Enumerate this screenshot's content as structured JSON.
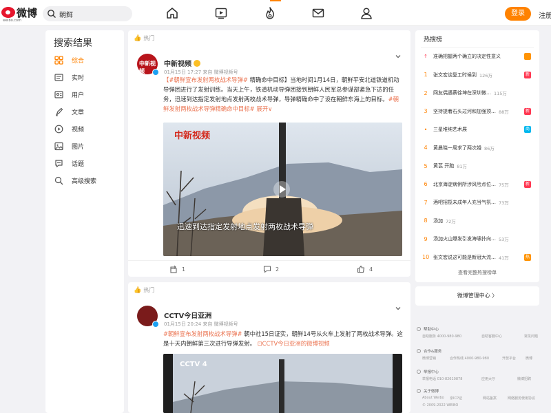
{
  "header": {
    "logo_text": "微博",
    "logo_sub": "weibo.com",
    "search_value": "朝鲜",
    "login_label": "登录",
    "register_label": "注册",
    "nav_icons": [
      "home-icon",
      "video-icon",
      "hot-fire-icon",
      "message-icon",
      "profile-icon"
    ]
  },
  "sidebar": {
    "title": "搜索结果",
    "items": [
      {
        "label": "综合",
        "icon": "grid-icon"
      },
      {
        "label": "实时",
        "icon": "realtime-icon"
      },
      {
        "label": "用户",
        "icon": "user-icon"
      },
      {
        "label": "文章",
        "icon": "article-icon"
      },
      {
        "label": "视频",
        "icon": "video-play-icon"
      },
      {
        "label": "图片",
        "icon": "image-icon"
      },
      {
        "label": "话题",
        "icon": "topic-icon"
      },
      {
        "label": "高级搜索",
        "icon": "advanced-search-icon"
      }
    ]
  },
  "posts": [
    {
      "tag": "热门",
      "author": "中新视频",
      "meta": "01月15日 17:27  来自 微博视频号",
      "text_hashtag": "【#朝鲜宣布发射两枚战术导弹#",
      "text_body": " 精确命中目标】当地时间1月14日，朝鲜平安北道铁道机动导弹团进行了发射训练。当天上午，铁道机动导弹团接到朝鲜人民军总参谋部紧急下达的任务，迅速到达指定发射地点发射两枚战术导弹，导弹精确命中了设在朝鲜东海上的目标。",
      "text_hashtag2": "#朝鲜发射两枚战术导弹精确命中目标#",
      "expand": " 展开∨",
      "media_watermark": "中新视频",
      "media_caption": "迅速到达指定发射地点发射两枚战术导弹",
      "repost": "",
      "comments": "2",
      "likes": "4",
      "repost_count": "1"
    },
    {
      "tag": "热门",
      "author": "CCTV今日亚洲",
      "meta": "01月15日 20:24  来自 微博视频号",
      "text_hashtag": "#朝鲜宣布发射两枚战术导弹#",
      "text_body": " 朝中社15日证实，朝鲜14号从火车上发射了两枚战术导弹。这是十天内朝鲜第三次进行导弹发射。",
      "text_link": " ⊡CCTV今日亚洲的微博视频",
      "media_watermark": "CCTV 4"
    }
  ],
  "hot_search": {
    "title": "热搜榜",
    "items": [
      {
        "rank": "↑",
        "word": "准确把握两个确立的决定性意义",
        "num": "",
        "badge": "",
        "badge_color": "#ff9406"
      },
      {
        "rank": "1",
        "word": "张文宏谈复工时候到",
        "num": "126万",
        "badge": "新",
        "badge_color": "#ff3852"
      },
      {
        "rank": "2",
        "word": "网友偶遇蔡徐坤在深圳做…",
        "num": "115万",
        "badge": "",
        "badge_color": ""
      },
      {
        "rank": "3",
        "word": "坚持提着石头过河和加强顶…",
        "num": "88万",
        "badge": "新",
        "badge_color": "#ff3852"
      },
      {
        "rank": "•",
        "word": "三星堆纯艺术展",
        "num": "",
        "badge": "商",
        "badge_color": "#00b7ee"
      },
      {
        "rank": "4",
        "word": "黄晨晓一周求了两次婚",
        "num": "86万",
        "badge": "",
        "badge_color": ""
      },
      {
        "rank": "5",
        "word": "黄芪 开跑",
        "num": "81万",
        "badge": "",
        "badge_color": ""
      },
      {
        "rank": "6",
        "word": "北京海淀病例所涉风险点位…",
        "num": "75万",
        "badge": "新",
        "badge_color": "#ff3852"
      },
      {
        "rank": "7",
        "word": "酒吧招揽未成年人充当气氛…",
        "num": "73万",
        "badge": "",
        "badge_color": ""
      },
      {
        "rank": "8",
        "word": "汤加",
        "num": "72万",
        "badge": "",
        "badge_color": ""
      },
      {
        "rank": "9",
        "word": "汤加火山爆发引发海啸扑向…",
        "num": "53万",
        "badge": "",
        "badge_color": ""
      },
      {
        "rank": "10",
        "word": "张文宏说这可能是新冠大流…",
        "num": "41万",
        "badge": "热",
        "badge_color": "#ff9406"
      }
    ],
    "more": "查看完整热搜榜单"
  },
  "management": "微博管理中心  〉",
  "footer": [
    {
      "head": "帮助中心",
      "links": [
        "自助服务 4000-980-980",
        "自助客服中心",
        "常见问题"
      ]
    },
    {
      "head": "合作&服务",
      "links": [
        "微博营销",
        "合作热线 4000-980-980",
        "开放平台",
        "微博"
      ]
    },
    {
      "head": "举报中心",
      "links": [
        "举报电话 010-82610878",
        "应用大厅",
        "微博招聘"
      ]
    },
    {
      "head": "关于微博",
      "links": [
        "About Weibo",
        "京ICP证",
        "网站备案",
        "网络服务使用协议"
      ]
    }
  ],
  "copyright": "© 2009-2022 WEIBO"
}
